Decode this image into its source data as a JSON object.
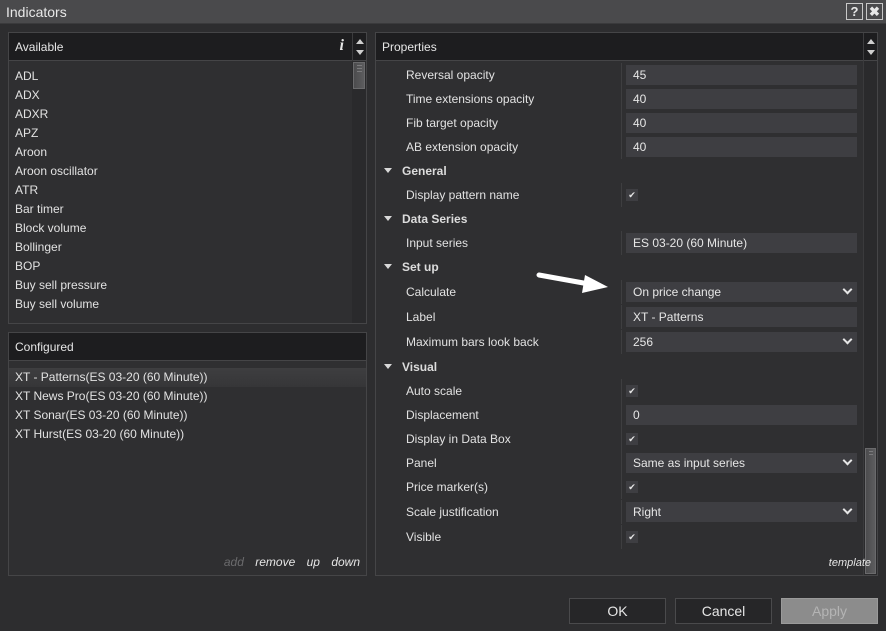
{
  "window": {
    "title": "Indicators",
    "help_label": "?",
    "close_label": "✖"
  },
  "available": {
    "header": "Available",
    "info_icon": "i",
    "items": [
      "ADL",
      "ADX",
      "ADXR",
      "APZ",
      "Aroon",
      "Aroon oscillator",
      "ATR",
      "Bar timer",
      "Block volume",
      "Bollinger",
      "BOP",
      "Buy sell pressure",
      "Buy sell volume"
    ]
  },
  "configured": {
    "header": "Configured",
    "items": [
      "XT - Patterns(ES 03-20 (60 Minute))",
      "XT News Pro(ES 03-20 (60 Minute))",
      "XT Sonar(ES 03-20 (60 Minute))",
      "XT Hurst(ES 03-20 (60 Minute))"
    ],
    "selected_index": 0,
    "actions": {
      "add": "add",
      "remove": "remove",
      "up": "up",
      "down": "down"
    }
  },
  "properties": {
    "header": "Properties",
    "rows": {
      "reversal_opacity": {
        "label": "Reversal opacity",
        "value": "45"
      },
      "time_ext_opacity": {
        "label": "Time extensions opacity",
        "value": "40"
      },
      "fib_target_opacity": {
        "label": "Fib target opacity",
        "value": "40"
      },
      "ab_ext_opacity": {
        "label": "AB extension opacity",
        "value": "40"
      },
      "general": {
        "label": "General"
      },
      "display_pattern_name": {
        "label": "Display pattern name",
        "checked": true
      },
      "data_series": {
        "label": "Data Series"
      },
      "input_series": {
        "label": "Input series",
        "value": "ES 03-20 (60 Minute)"
      },
      "setup": {
        "label": "Set up"
      },
      "calculate": {
        "label": "Calculate",
        "value": "On price change"
      },
      "label": {
        "label": "Label",
        "value": "XT - Patterns"
      },
      "max_bars": {
        "label": "Maximum bars look back",
        "value": "256"
      },
      "visual": {
        "label": "Visual"
      },
      "auto_scale": {
        "label": "Auto scale",
        "checked": true
      },
      "displacement": {
        "label": "Displacement",
        "value": "0"
      },
      "display_data_box": {
        "label": "Display in Data Box",
        "checked": true
      },
      "panel": {
        "label": "Panel",
        "value": "Same as input series"
      },
      "price_markers": {
        "label": "Price marker(s)",
        "checked": true
      },
      "scale_justification": {
        "label": "Scale justification",
        "value": "Right"
      },
      "visible": {
        "label": "Visible",
        "checked": true
      }
    },
    "check_glyph": "✔",
    "template_link": "template"
  },
  "buttons": {
    "ok": "OK",
    "cancel": "Cancel",
    "apply": "Apply"
  }
}
